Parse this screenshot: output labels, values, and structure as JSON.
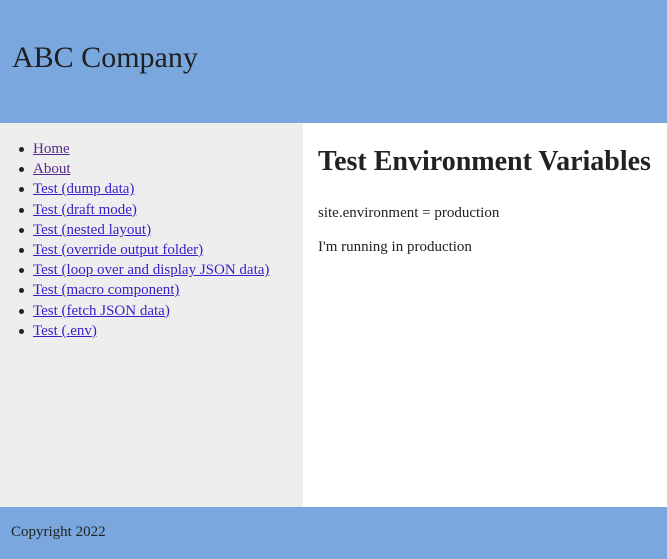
{
  "header": {
    "brand": "ABC Company"
  },
  "nav": {
    "items": [
      {
        "label": "Home",
        "visited": true
      },
      {
        "label": "About",
        "visited": true
      },
      {
        "label": "Test (dump data)",
        "visited": false
      },
      {
        "label": "Test (draft mode)",
        "visited": false
      },
      {
        "label": "Test (nested layout)",
        "visited": false
      },
      {
        "label": "Test (override output folder)",
        "visited": false
      },
      {
        "label": "Test (loop over and display JSON data)",
        "visited": false
      },
      {
        "label": "Test (macro component)",
        "visited": false
      },
      {
        "label": "Test (fetch JSON data)",
        "visited": false
      },
      {
        "label": "Test (.env)",
        "visited": false
      }
    ]
  },
  "main": {
    "title": "Test Environment Variables",
    "env_line": "site.environment = production",
    "status_line": "I'm running in production"
  },
  "footer": {
    "copyright": "Copyright 2022"
  },
  "colors": {
    "header_bg": "#7aa7dd",
    "sidebar_bg": "#eeeeee",
    "link": "#3a1ec8",
    "link_visited": "#5a2a8a"
  }
}
